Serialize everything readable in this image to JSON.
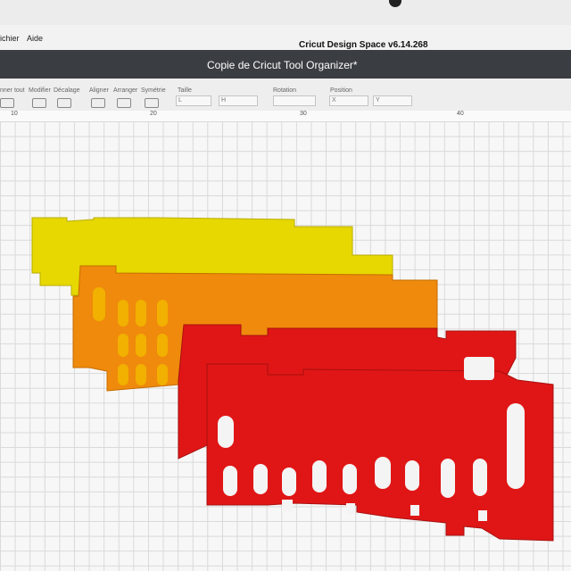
{
  "menu": {
    "items": [
      "ichier",
      "Aide"
    ]
  },
  "app": {
    "title": "Cricut Design Space  v6.14.268"
  },
  "document": {
    "title": "Copie de Cricut Tool Organizer*"
  },
  "toolbar": {
    "select_all": "nner tout",
    "modifier": "Modifier",
    "decalage": "Décalage",
    "aligner": "Aligner",
    "arranger": "Arranger",
    "symetrie": "Symétrie",
    "taille": "Taille",
    "rotation": "Rotation",
    "position": "Position",
    "field_l": "L",
    "field_h": "H",
    "field_x": "X",
    "field_y": "Y"
  },
  "ruler": {
    "ticks": [
      "10",
      "20",
      "30",
      "40"
    ]
  },
  "shapes": {
    "colors": {
      "yellow": "#e6d800",
      "orange": "#ef8a0c",
      "red": "#e01616"
    }
  }
}
